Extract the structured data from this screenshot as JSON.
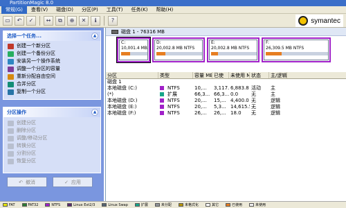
{
  "window": {
    "title": "PartitionMagic 8.0"
  },
  "menu": [
    "常规(G)",
    "查看(V)",
    "磁盘(D)",
    "分区(P)",
    "工具(T)",
    "任务(K)",
    "帮助(H)"
  ],
  "logo": {
    "text": "symantec"
  },
  "tasks_panel": {
    "title": "选择一个任务...",
    "items": [
      {
        "label": "创建一个新分区",
        "icon": "create-partition-icon",
        "color": "#c0392b"
      },
      {
        "label": "创建一个备份分区",
        "icon": "backup-partition-icon",
        "color": "#27ae60"
      },
      {
        "label": "安装另一个操作系统",
        "icon": "install-os-icon",
        "color": "#2e86c1"
      },
      {
        "label": "调整一个分区的容量",
        "icon": "resize-partition-icon",
        "color": "#7d3c98"
      },
      {
        "label": "重新分配自由空间",
        "icon": "redistribute-space-icon",
        "color": "#d68910"
      },
      {
        "label": "合并分区",
        "icon": "merge-partition-icon",
        "color": "#138d75"
      },
      {
        "label": "复制一个分区",
        "icon": "copy-partition-icon",
        "color": "#2874a6"
      }
    ]
  },
  "ops_panel": {
    "title": "分区操作",
    "items": [
      "创建分区",
      "删除分区",
      "调整/移动分区",
      "转换分区",
      "分割分区",
      "恢复分区"
    ]
  },
  "buttons": {
    "undo": "撤消",
    "apply": "应用"
  },
  "disk": {
    "header": "磁盘 1 - 76316 MB",
    "partitions": [
      {
        "letter": "C:",
        "size": "10,001.4 MB",
        "fs": "",
        "used": 0.35,
        "selected": true
      },
      {
        "letter": "D:",
        "size": "20,002.8 MB",
        "fs": "NTFS",
        "used": 0.2,
        "selected": false
      },
      {
        "letter": "E:",
        "size": "20,002.8 MB",
        "fs": "NTFS",
        "used": 0.15,
        "selected": false
      },
      {
        "letter": "F:",
        "size": "26,309.5 MB",
        "fs": "NTFS",
        "used": 0.25,
        "selected": false
      }
    ]
  },
  "table": {
    "columns": [
      "分区",
      "类型",
      "容量 MB",
      "已使",
      "未使用 MB",
      "状态",
      "主/逻辑"
    ],
    "group": "磁盘 1",
    "rows": [
      {
        "name": "本地磁盘 (C:)",
        "type": "NTFS",
        "color": "#a020c8",
        "cap": "10,...",
        "used": "3,117.6",
        "free": "6,883.8",
        "status": "活动",
        "kind": "主"
      },
      {
        "name": "(*)",
        "type": "扩展",
        "color": "#17a589",
        "cap": "66,3...",
        "used": "66,3...",
        "free": "0.0",
        "status": "无",
        "kind": "主"
      },
      {
        "name": "本地磁盘 (D:)",
        "type": "NTFS",
        "color": "#a020c8",
        "cap": "20,...",
        "used": "15,...",
        "free": "4,400.0",
        "status": "无",
        "kind": "逻辑"
      },
      {
        "name": "本地磁盘 (E:)",
        "type": "NTFS",
        "color": "#a020c8",
        "cap": "20,...",
        "used": "5,3...",
        "free": "14,615.5",
        "status": "无",
        "kind": "逻辑"
      },
      {
        "name": "本地磁盘 (F:)",
        "type": "NTFS",
        "color": "#a020c8",
        "cap": "26,...",
        "used": "26,...",
        "free": "18.0",
        "status": "无",
        "kind": "逻辑"
      }
    ]
  },
  "legend": [
    {
      "label": "FAT",
      "color": "#e6e600"
    },
    {
      "label": "FAT32",
      "color": "#2e7d32"
    },
    {
      "label": "NTFS",
      "color": "#a020c8"
    },
    {
      "label": "Linux Ext2/3",
      "color": "#5b2c6f"
    },
    {
      "label": "Linux Swap",
      "color": "#566573"
    },
    {
      "label": "扩展",
      "color": "#17a589"
    },
    {
      "label": "未分配",
      "color": "#909497"
    },
    {
      "label": "未格式化",
      "color": "#b7950b"
    },
    {
      "label": "其它",
      "color": "#ffffff"
    },
    {
      "label": "已使用",
      "color": "#e67e22"
    },
    {
      "label": "未使用",
      "color": "#f0f0f0"
    }
  ],
  "status": "0 操作未完成"
}
